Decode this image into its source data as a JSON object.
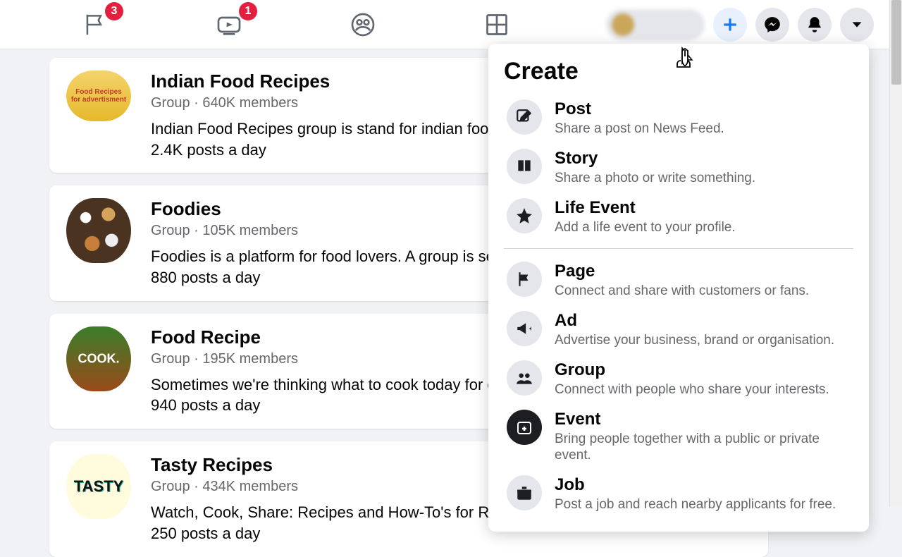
{
  "topbar": {
    "pages_badge": "3",
    "watch_badge": "1"
  },
  "create_menu": {
    "title": "Create",
    "items": [
      {
        "title": "Post",
        "desc": "Share a post on News Feed."
      },
      {
        "title": "Story",
        "desc": "Share a photo or write something."
      },
      {
        "title": "Life Event",
        "desc": "Add a life event to your profile."
      }
    ],
    "items2": [
      {
        "title": "Page",
        "desc": "Connect and share with customers or fans."
      },
      {
        "title": "Ad",
        "desc": "Advertise your business, brand or organisation."
      },
      {
        "title": "Group",
        "desc": "Connect with people who share your interests."
      },
      {
        "title": "Event",
        "desc": "Bring people together with a public or private event."
      },
      {
        "title": "Job",
        "desc": "Post a job and reach nearby applicants for free."
      }
    ]
  },
  "groups": [
    {
      "title": "Indian Food Recipes",
      "sub": "Group · 640K members",
      "desc1": "Indian Food Recipes group is stand for indian food recipes sharing and more",
      "desc2": "2.4K posts a day"
    },
    {
      "title": "Foodies",
      "sub": "Group · 105K members",
      "desc1": "Foodies is a platform for food lovers. A group is set up to share recipes",
      "desc2": "880 posts a day"
    },
    {
      "title": "Food Recipe",
      "sub": "Group · 195K members",
      "desc1": "Sometimes we're thinking what to cook today for our family and friends",
      "desc2": "940 posts a day"
    },
    {
      "title": "Tasty Recipes",
      "sub": "Group · 434K members",
      "desc1": "Watch, Cook, Share: Recipes and How-To's for Real people just like you",
      "desc2": "250 posts a day"
    }
  ]
}
